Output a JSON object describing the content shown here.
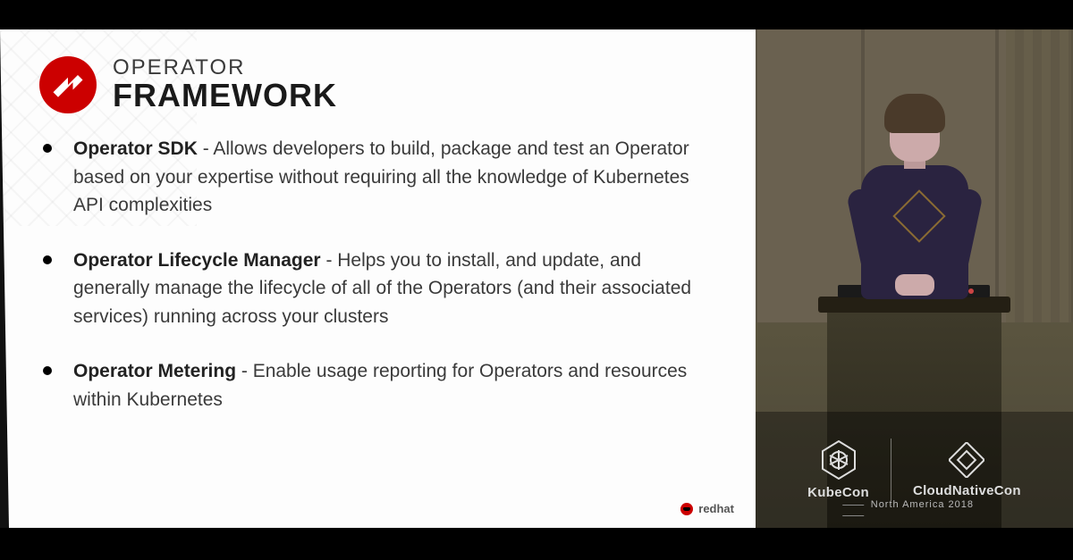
{
  "slide": {
    "logo_name": "operator-framework-logo",
    "title_small": "OPERATOR",
    "title_big": "FRAMEWORK",
    "bullets": [
      {
        "term": "Operator SDK",
        "desc": " - Allows developers to build, package and test an Operator based on your expertise without requiring all the knowledge of Kubernetes API complexities"
      },
      {
        "term": "Operator Lifecycle Manager",
        "desc": " - Helps you to install, and update, and generally manage the lifecycle of all of the Operators (and their associated services) running across your clusters"
      },
      {
        "term": "Operator Metering",
        "desc": " - Enable usage reporting for Operators and resources within Kubernetes"
      }
    ],
    "brand": "redhat"
  },
  "conference": {
    "left_label": "KubeCon",
    "right_label": "CloudNativeCon",
    "subtitle": "North America 2018"
  }
}
